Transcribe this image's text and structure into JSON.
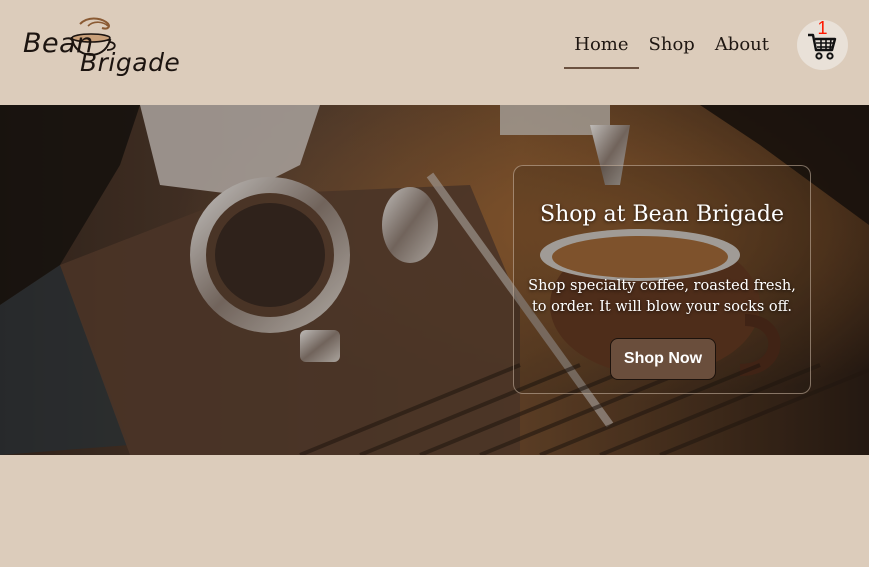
{
  "brand": {
    "logo_word1": "Bean",
    "logo_word2": "Brigade"
  },
  "nav": {
    "items": [
      {
        "label": "Home",
        "active": true
      },
      {
        "label": "Shop",
        "active": false
      },
      {
        "label": "About",
        "active": false
      }
    ]
  },
  "cart": {
    "count": "1",
    "icon": "shopping-cart-icon"
  },
  "hero": {
    "title": "Shop at Bean Brigade",
    "subtitle": "Shop specialty coffee, roasted fresh, to order. It will blow your socks off.",
    "cta_label": "Shop Now"
  },
  "colors": {
    "background": "#dcccbb",
    "button": "#6a4e3c",
    "cart_badge": "#ff1800",
    "nav_underline": "#6b5140"
  }
}
